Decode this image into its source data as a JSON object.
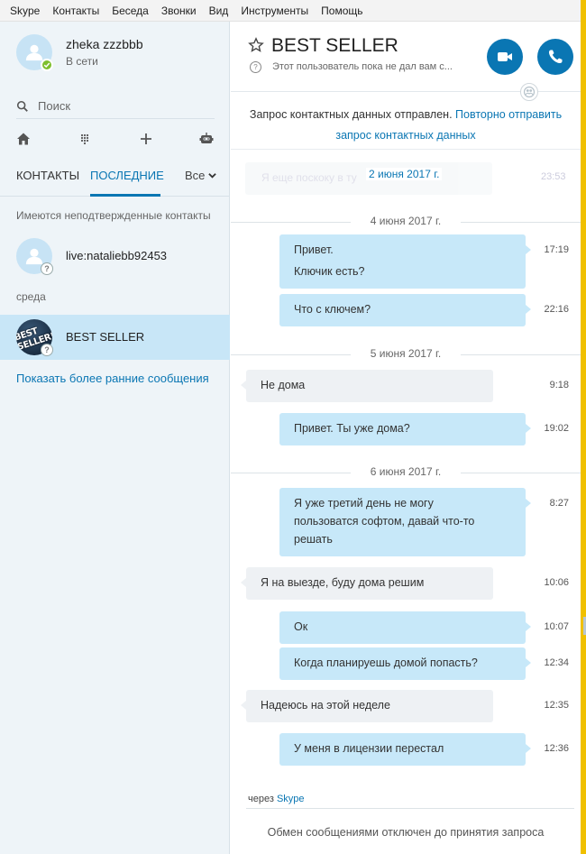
{
  "menu": [
    "Skype",
    "Контакты",
    "Беседа",
    "Звонки",
    "Вид",
    "Инструменты",
    "Помощь"
  ],
  "profile": {
    "name": "zheka zzzbbb",
    "status": "В сети"
  },
  "search": {
    "label": "Поиск"
  },
  "tabs": {
    "contacts": "КОНТАКТЫ",
    "recent": "ПОСЛЕДНИЕ",
    "filter": "Все"
  },
  "sections": {
    "unconfirmed": "Имеются неподтвержденные контакты",
    "wednesday": "среда"
  },
  "contacts": [
    {
      "name": "live:nataliebb92453"
    },
    {
      "name": "BEST SELLER",
      "logo_text": "BEST SELLER!"
    }
  ],
  "show_earlier": "Показать более ранние сообщения",
  "chat": {
    "title": "BEST SELLER",
    "mood": "Этот пользователь пока не дал вам с...",
    "request_text": "Запрос контактных данных отправлен.",
    "request_link": "Повторно отправить запрос контактных данных",
    "ghost_text": "Я еще поскоку в ту",
    "ghost_time": "23:53"
  },
  "dates": [
    "2 июня 2017 г.",
    "4 июня 2017 г.",
    "5 июня 2017 г.",
    "6 июня 2017 г."
  ],
  "messages": [
    {
      "dir": "out",
      "lines": [
        "Привет.",
        "Ключик есть?"
      ],
      "time": "17:19"
    },
    {
      "dir": "out",
      "lines": [
        "Что с ключем?"
      ],
      "time": "22:16"
    },
    {
      "dir": "in",
      "lines": [
        "Не дома"
      ],
      "time": "9:18"
    },
    {
      "dir": "out",
      "lines": [
        "Привет. Ты уже дома?"
      ],
      "time": "19:02"
    },
    {
      "dir": "out",
      "lines": [
        "Я уже третий день не могу",
        "пользоватся софтом, давай что-то",
        "решать"
      ],
      "time": "8:27"
    },
    {
      "dir": "in",
      "lines": [
        "Я на выезде, буду дома решим"
      ],
      "time": "10:06"
    },
    {
      "dir": "out",
      "lines": [
        "Ок"
      ],
      "time": "10:07"
    },
    {
      "dir": "out",
      "lines": [
        "Когда планируешь домой попасть?"
      ],
      "time": "12:34"
    },
    {
      "dir": "in",
      "lines": [
        "Надеюсь на этой неделе"
      ],
      "time": "12:35"
    },
    {
      "dir": "out",
      "lines": [
        "У меня в лицензии перестал"
      ],
      "time": "12:36"
    }
  ],
  "footer": {
    "via_prefix": "через",
    "via_link": "Skype",
    "disabled": "Обмен сообщениями отключен до принятия запроса"
  },
  "colors": {
    "accent": "#0a76b3",
    "bubble_out": "#c7e8f9",
    "bubble_in": "#eef1f4",
    "online": "#7dbf2d"
  }
}
